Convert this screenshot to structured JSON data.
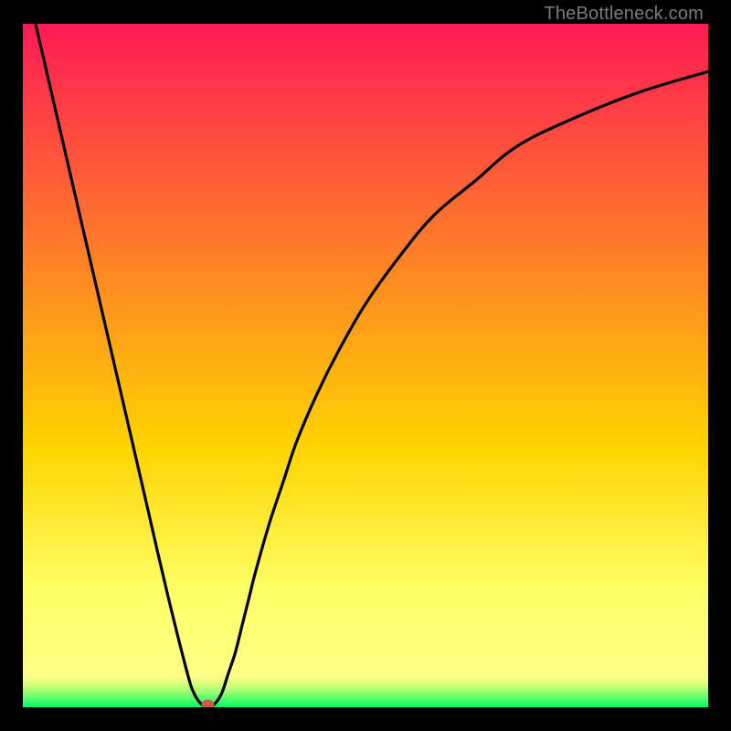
{
  "attribution": "TheBottleneck.com",
  "colors": {
    "gradient_top": "#ff1a55",
    "gradient_mid_upper": "#ff7a2a",
    "gradient_mid": "#ffd400",
    "gradient_lower": "#ffff66",
    "gradient_bottom": "#00ff66",
    "curve": "#000000",
    "marker": "#cc5a4a",
    "frame_bg": "#000000"
  },
  "chart_data": {
    "type": "line",
    "title": "",
    "xlabel": "",
    "ylabel": "",
    "xlim": [
      0,
      100
    ],
    "ylim": [
      0,
      100
    ],
    "grid": false,
    "legend": false,
    "series": [
      {
        "name": "bottleneck-curve",
        "x": [
          0,
          3,
          6,
          9,
          12,
          15,
          18,
          21,
          24,
          25,
          26,
          27,
          28,
          29,
          30,
          31,
          32,
          33,
          34,
          36,
          38,
          40,
          43,
          46,
          50,
          55,
          60,
          66,
          72,
          80,
          90,
          100
        ],
        "y": [
          108,
          95,
          82,
          69,
          56,
          43,
          30,
          17,
          5,
          2,
          0.5,
          0,
          0.5,
          2,
          5,
          8,
          12,
          16,
          20,
          27,
          33,
          39,
          46,
          52,
          59,
          66,
          72,
          77,
          82,
          86,
          90,
          93
        ]
      }
    ],
    "marker": {
      "x": 27,
      "y": 0,
      "label": "min-point"
    },
    "background_bands": [
      {
        "from_y": 0,
        "to_y": 2,
        "color": "#00ff66"
      },
      {
        "from_y": 2,
        "to_y": 5,
        "color": "#88ff66"
      },
      {
        "from_y": 5,
        "to_y": 12,
        "color": "#ffff66"
      },
      {
        "from_y": 12,
        "to_y": 45,
        "color": "#ffd400"
      },
      {
        "from_y": 45,
        "to_y": 75,
        "color": "#ff7a2a"
      },
      {
        "from_y": 75,
        "to_y": 100,
        "color": "#ff1a55"
      }
    ]
  }
}
